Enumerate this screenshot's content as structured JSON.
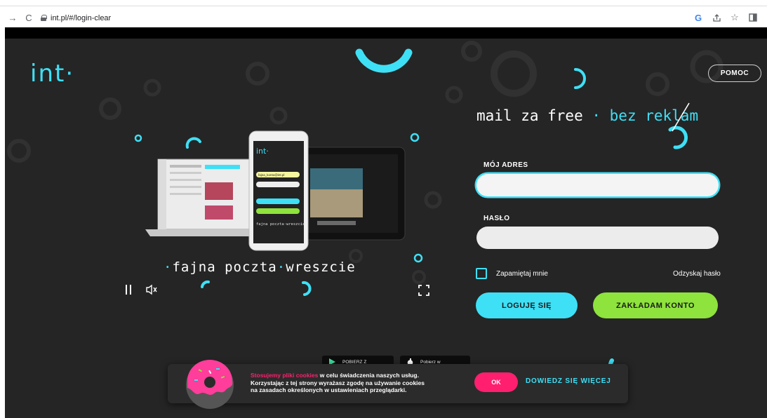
{
  "browser": {
    "url": "int.pl/#/login-clear",
    "back_icon": "arrow-forward-icon",
    "reload_icon": "reload-icon"
  },
  "header": {
    "logo_text": "int·",
    "help_label": "POMOC"
  },
  "hero": {
    "tagline_part1": "mail za free",
    "tagline_dot": " · ",
    "tagline_part2": "bez reklam",
    "promo_dot1": "·",
    "promo_word1": "fajna poczta",
    "promo_dot2": "·",
    "promo_word2": "wreszcie",
    "phone_email": "fajna_konto@int.pl",
    "phone_caption": "fajna poczta·wreszcie",
    "phone_logo": "int·"
  },
  "login": {
    "address_label": "MÓJ ADRES",
    "address_value": "",
    "password_label": "HASŁO",
    "password_value": "",
    "remember_label": "Zapamiętaj mnie",
    "recover_label": "Odzyskaj hasło",
    "login_button": "LOGUJĘ SIĘ",
    "register_button": "ZAKŁADAM KONTO"
  },
  "stores": {
    "google_label": "POBIERZ Z",
    "apple_label": "Pobierz w"
  },
  "cookie": {
    "highlight": "Stosujemy pliki cookies",
    "text1": " w celu świadczenia naszych usług.",
    "text2": "Korzystając z tej strony wyrażasz zgodę na używanie cookies",
    "text3": "na zasadach określonych w ustawieniach przeglądarki.",
    "ok_label": "OK",
    "more_label": "DOWIEDZ SIĘ WIĘCEJ"
  },
  "colors": {
    "accent_cyan": "#3ee0f6",
    "accent_green": "#8ee33c",
    "accent_pink": "#ff1f6e",
    "background": "#252525"
  }
}
